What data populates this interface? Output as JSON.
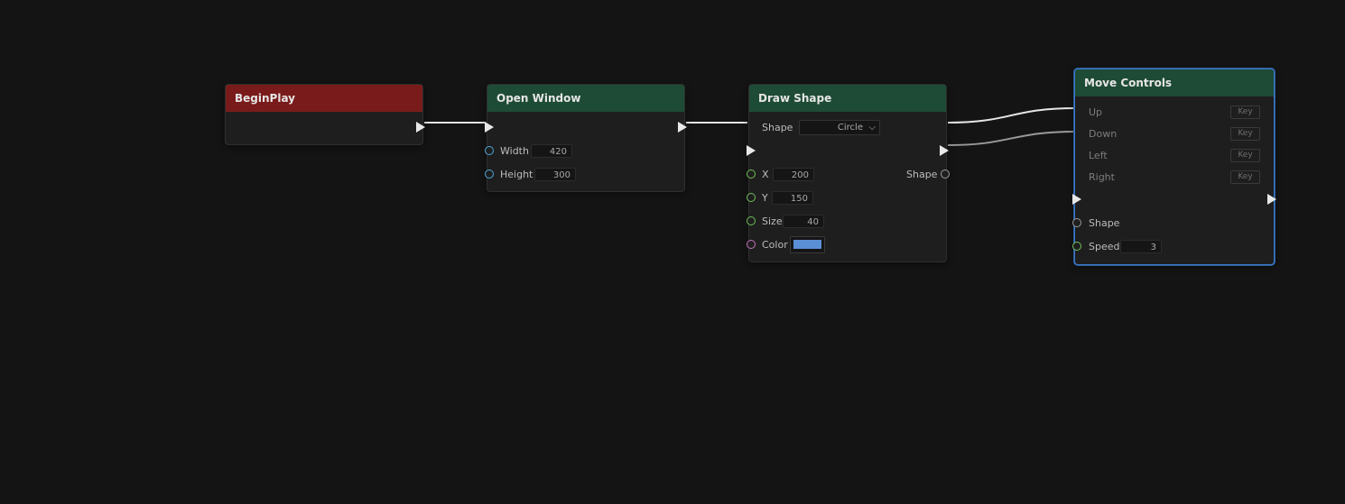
{
  "colors": {
    "background": "#141414",
    "event_header": "#7a1b1b",
    "function_header": "#1e4b35",
    "selection": "#3b78c8",
    "wire": "#e6e6e6",
    "color_swatch": "#5a8fd6"
  },
  "nodes": {
    "begin_play": {
      "title": "BeginPlay"
    },
    "open_window": {
      "title": "Open Window",
      "width_label": "Width",
      "width_value": "420",
      "height_label": "Height",
      "height_value": "300"
    },
    "draw_shape": {
      "title": "Draw Shape",
      "shape_label": "Shape",
      "shape_selected": "Circle",
      "x_label": "X",
      "x_value": "200",
      "y_label": "Y",
      "y_value": "150",
      "size_label": "Size",
      "size_value": "40",
      "color_label": "Color",
      "out_shape_label": "Shape"
    },
    "move_controls": {
      "title": "Move Controls",
      "up_label": "Up",
      "down_label": "Down",
      "left_label": "Left",
      "right_label": "Right",
      "key_placeholder": "Key",
      "shape_label": "Shape",
      "speed_label": "Speed",
      "speed_value": "3"
    }
  }
}
